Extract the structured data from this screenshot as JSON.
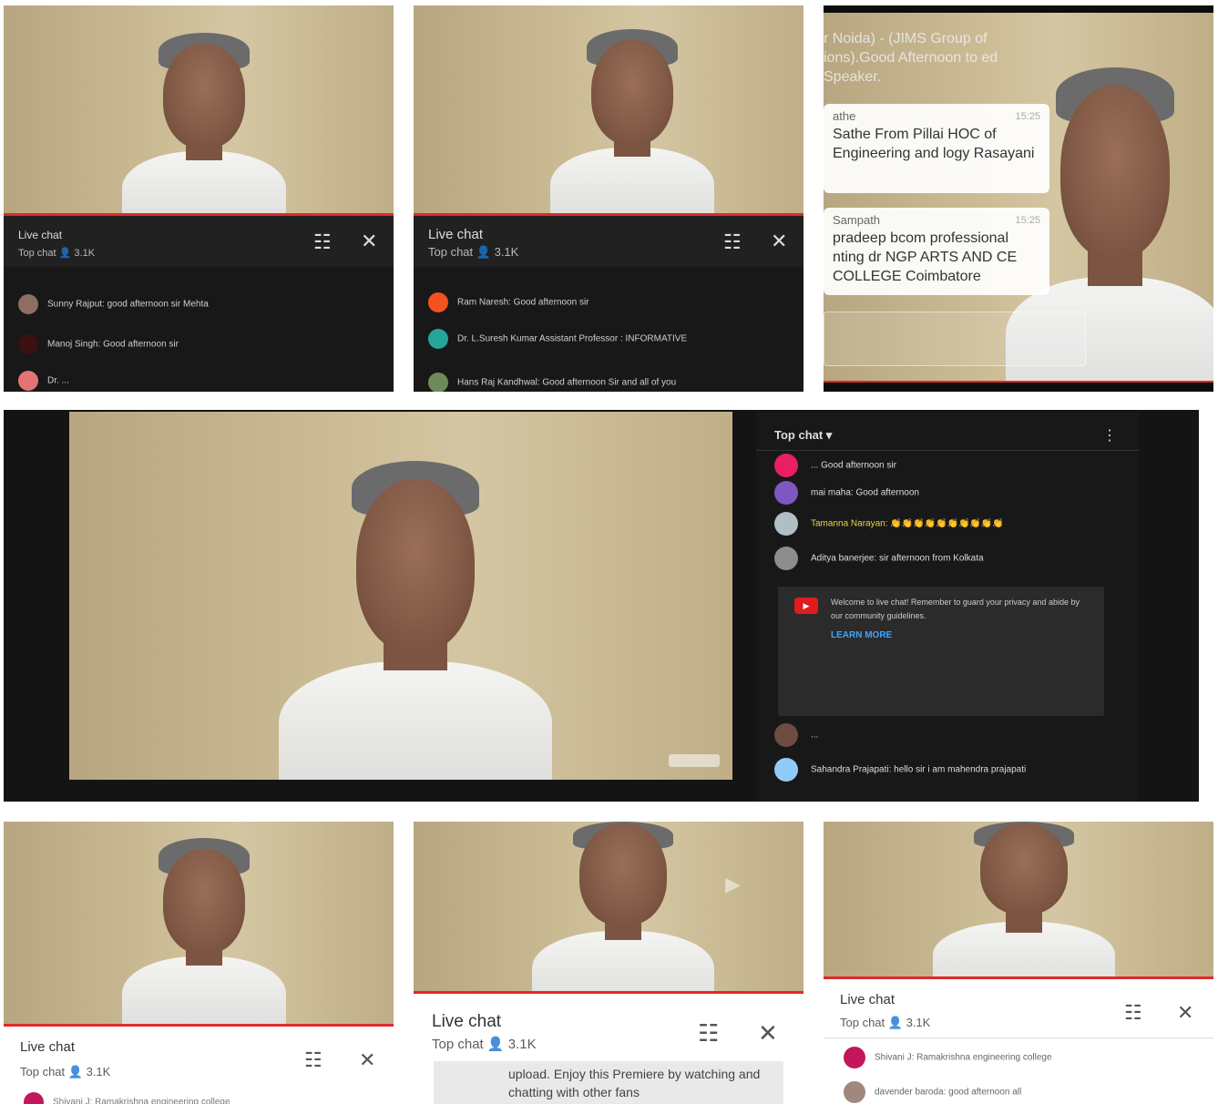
{
  "chat": {
    "live_title": "Live chat",
    "top_chat": "Top chat",
    "viewers": "3.1K",
    "tune_icon": "tune-icon",
    "close_icon": "close-icon"
  },
  "panel1": {
    "messages": [
      "Sunny Rajput: good afternoon sir Mehta",
      "Manoj Singh: Good afternoon sir",
      "Dr. ..."
    ]
  },
  "panel2": {
    "messages": [
      "Ram Naresh: Good afternoon sir",
      "Dr. L.Suresh Kumar Assistant Professor : INFORMATIVE",
      "Hans Raj Kandhwal: Good afternoon Sir and all of you"
    ]
  },
  "panel3": {
    "top_text": "r Noida) - (JIMS Group of ions).Good Afternoon to ed Speaker.",
    "bubbles": [
      {
        "name": "athe",
        "time": "15:25",
        "text": "Sathe From Pillai HOC of Engineering and logy Rasayani"
      },
      {
        "name": "Sampath",
        "time": "15:25",
        "text": "pradeep bcom professional nting dr NGP ARTS AND CE COLLEGE Coimbatore"
      }
    ]
  },
  "main": {
    "top_chat_label": "Top chat ▾",
    "more_icon": "more-vert-icon",
    "messages": [
      "... Good afternoon sir",
      "mai maha: Good afternoon",
      "Tamanna Narayan: 👏👏👏👏👏👏👏👏👏👏",
      "Aditya banerjee: sir afternoon from Kolkata",
      "Sahandra Prajapati: hello sir i am mahendra prajapati"
    ],
    "notice_text": "Welcome to live chat! Remember to guard your privacy and abide by our community guidelines.",
    "learn_more": "LEARN MORE"
  },
  "panel6": {
    "messages": [
      "Shivani J: Ramakrishna engineering college"
    ]
  },
  "panel5": {
    "promo": "upload. Enjoy this Premiere by watching and chatting with other fans"
  },
  "panel4": {
    "messages": [
      "Shivani J: Ramakrishna engineering college",
      "davender baroda: good afternoon all"
    ]
  }
}
